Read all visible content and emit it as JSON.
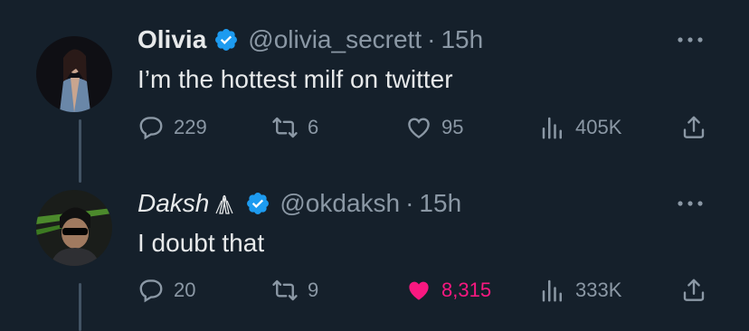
{
  "tweets": [
    {
      "name": "Olivia",
      "handle": "@olivia_secrett",
      "separator": "·",
      "time": "15h",
      "text": "I’m the hottest milf on twitter",
      "replies": "229",
      "retweets": "6",
      "likes": "95",
      "views": "405K",
      "liked": false
    },
    {
      "name": "Daksh",
      "name_decoration": "praying-hands-icon",
      "handle": "@okdaksh",
      "separator": "·",
      "time": "15h",
      "text": "I doubt that",
      "replies": "20",
      "retweets": "9",
      "likes": "8,315",
      "views": "333K",
      "liked": true
    }
  ],
  "colors": {
    "background": "#15202b",
    "text": "#e7e9ea",
    "muted": "#8b98a5",
    "verified": "#1d9bf0",
    "like_active": "#f91880",
    "thread_line": "#425364"
  }
}
